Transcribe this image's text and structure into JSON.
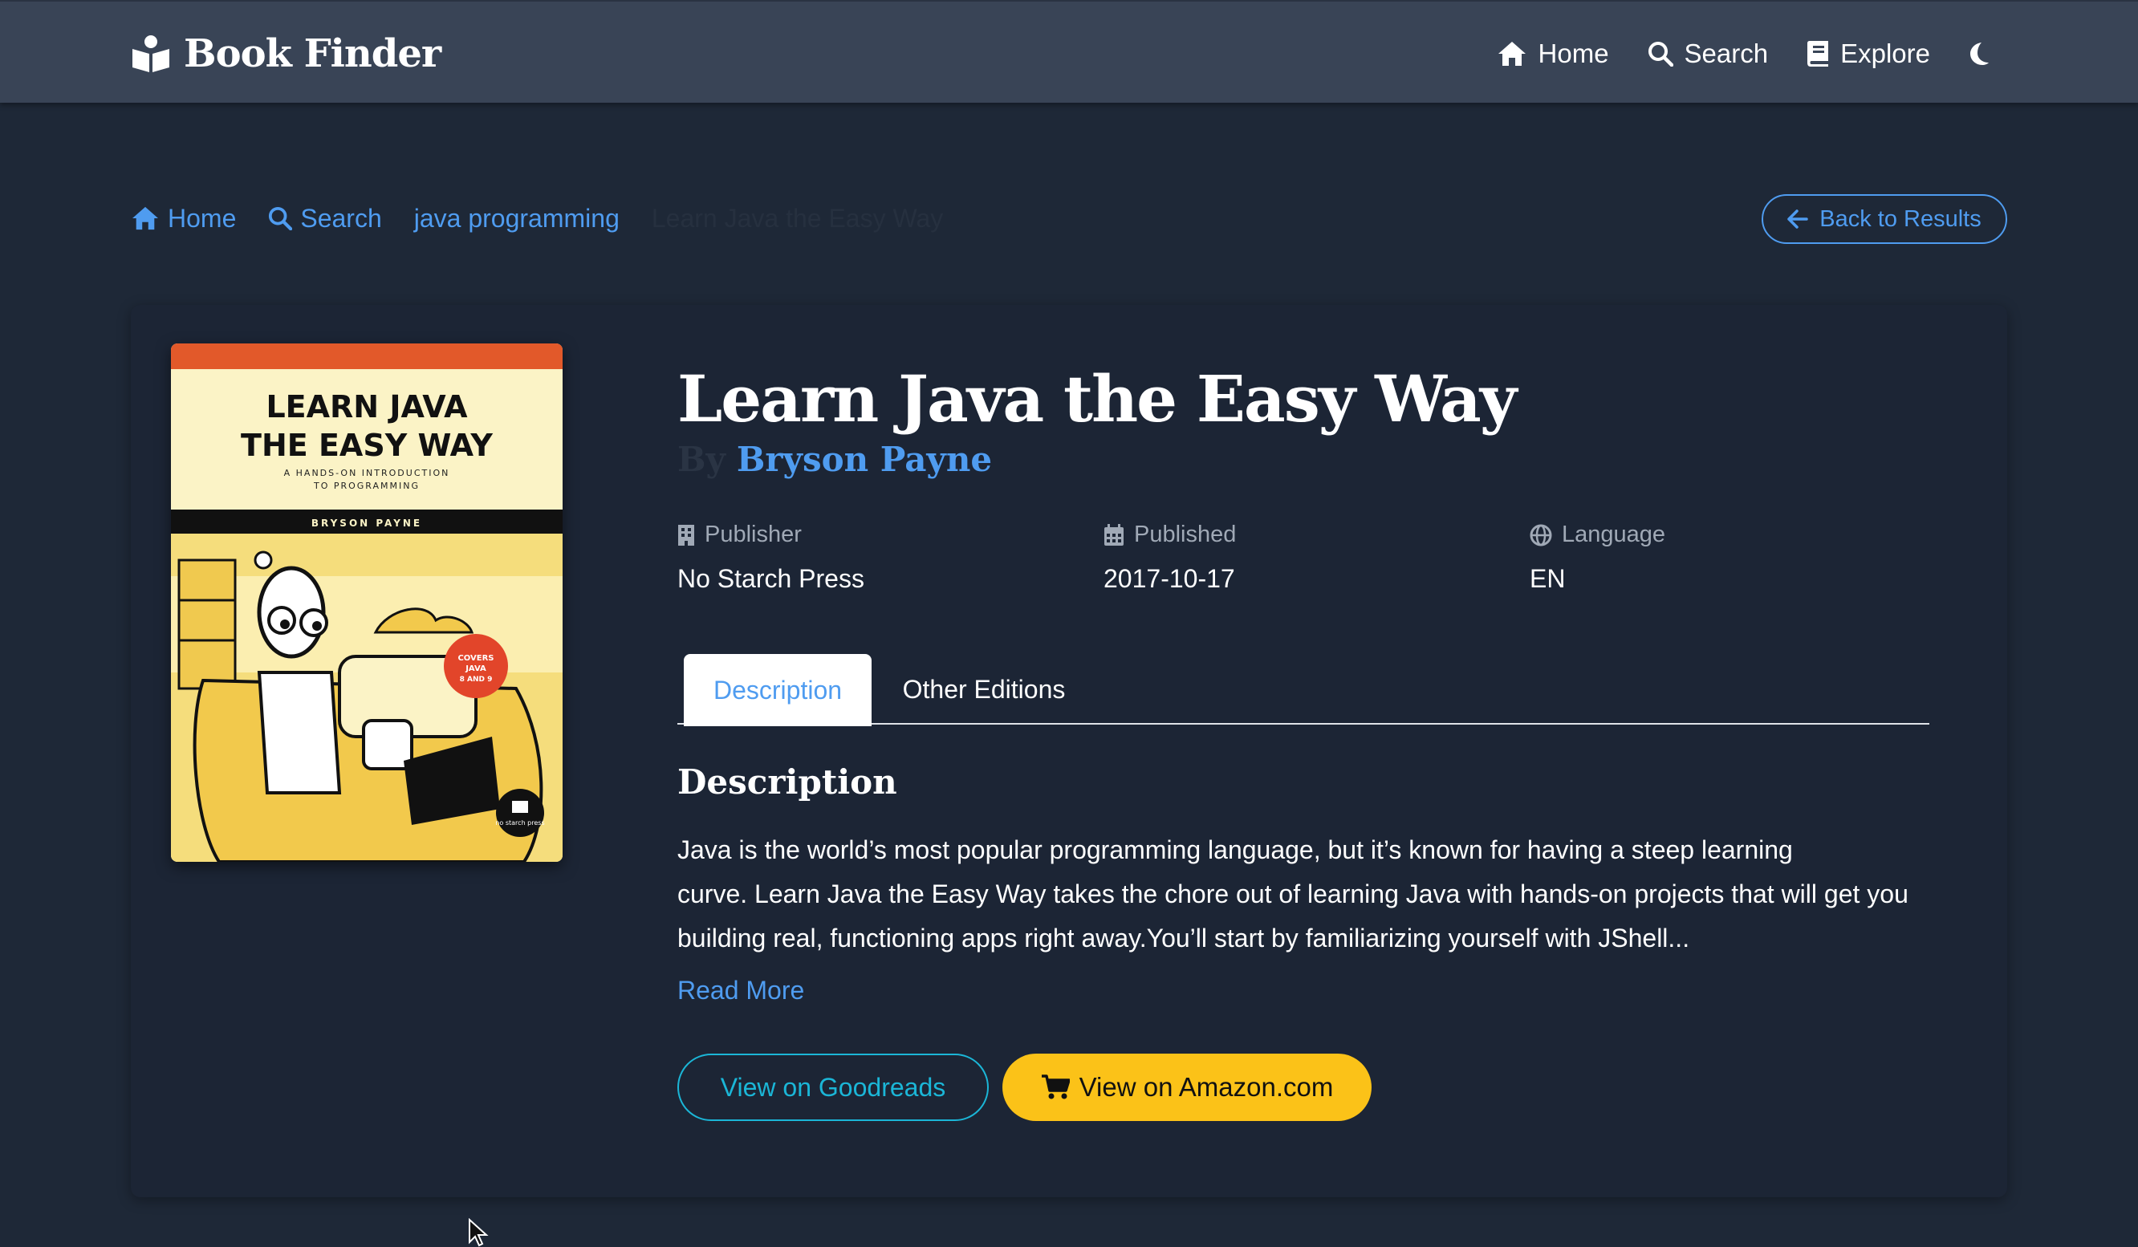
{
  "navbar": {
    "brand": "Book Finder",
    "brand_icon": "book-reader-icon",
    "links": [
      {
        "label": "Home",
        "icon": "home-icon"
      },
      {
        "label": "Search",
        "icon": "search-icon"
      },
      {
        "label": "Explore",
        "icon": "book-icon"
      }
    ],
    "theme_toggle_icon": "moon-icon"
  },
  "breadcrumb": {
    "items": [
      {
        "label": "Home",
        "icon": "home-icon"
      },
      {
        "label": "Search",
        "icon": "search-icon"
      },
      {
        "label": "java programming"
      }
    ],
    "current": "Learn Java the Easy Way"
  },
  "back_button": {
    "label": "Back to Results",
    "icon": "arrow-left-icon"
  },
  "book": {
    "title": "Learn Java the Easy Way",
    "by_label": "By",
    "author": "Bryson Payne",
    "cover": {
      "title_line1": "LEARN JAVA",
      "title_line2": "THE EASY WAY",
      "subtitle_line1": "A HANDS-ON INTRODUCTION",
      "subtitle_line2": "TO PROGRAMMING",
      "author": "BRYSON PAYNE",
      "badge_line1": "COVERS",
      "badge_line2": "JAVA",
      "badge_line3": "8 AND 9",
      "publisher_logo_text": "no starch press"
    },
    "meta": {
      "publisher": {
        "label": "Publisher",
        "value": "No Starch Press",
        "icon": "building-icon"
      },
      "published": {
        "label": "Published",
        "value": "2017-10-17",
        "icon": "calendar-icon"
      },
      "language": {
        "label": "Language",
        "value": "EN",
        "icon": "globe-icon"
      }
    },
    "tabs": [
      "Description",
      "Other Editions"
    ],
    "active_tab": "Description",
    "description_heading": "Description",
    "description_lines": [
      "Java is the world’s most popular programming language, but it’s known for having a steep learning",
      "curve. Learn Java the Easy Way takes the chore out of learning Java with hands-on projects that will get you",
      "building real, functioning apps right away.You’ll start by familiarizing yourself with JShell..."
    ],
    "read_more": "Read More",
    "goodreads_button": "View on Goodreads",
    "amazon_button": "View on Amazon.com",
    "amazon_icon": "cart-icon"
  },
  "colors": {
    "page_bg": "#1e2837",
    "navbar_bg": "#394456",
    "accent": "#4f9cf0",
    "goodreads": "#1bb6d7",
    "amazon": "#fbc218"
  }
}
